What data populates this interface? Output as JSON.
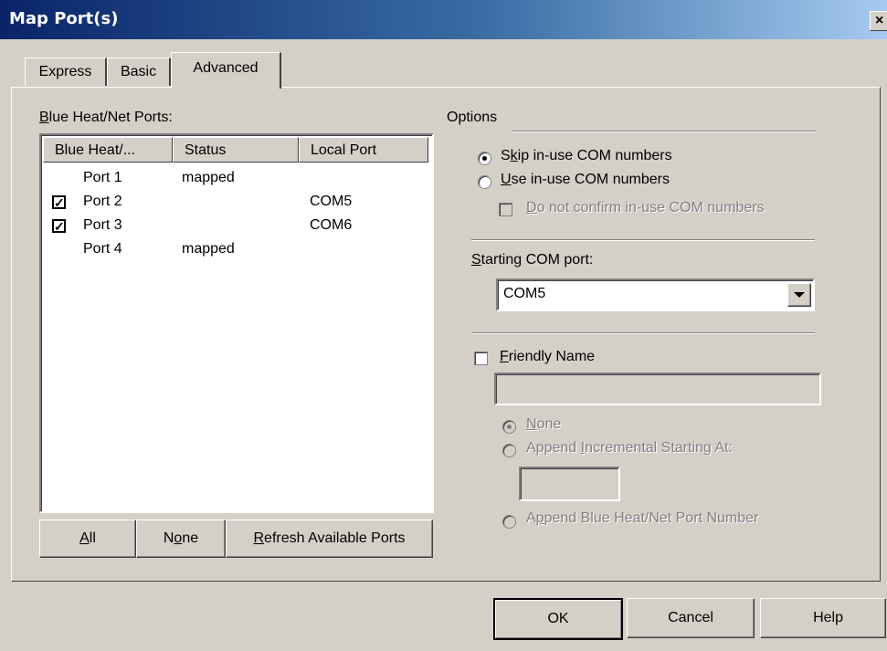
{
  "window": {
    "title": "Map Port(s)",
    "close_glyph": "×"
  },
  "tabs": [
    {
      "label": "Express"
    },
    {
      "label": "Basic"
    },
    {
      "label": "Advanced",
      "selected": true
    }
  ],
  "ports": {
    "label_prefix": "B",
    "label_rest": "lue Heat/Net Ports:",
    "columns": [
      "Blue Heat/...",
      "Status",
      "Local Port"
    ],
    "rows": [
      {
        "name": "Port 1",
        "status": "mapped",
        "local_port": "",
        "checkbox": false
      },
      {
        "name": "Port 2",
        "status": "",
        "local_port": "COM5",
        "checkbox": true
      },
      {
        "name": "Port 3",
        "status": "",
        "local_port": "COM6",
        "checkbox": true
      },
      {
        "name": "Port 4",
        "status": "mapped",
        "local_port": "",
        "checkbox": false
      }
    ],
    "check_glyph": "✓",
    "buttons": {
      "all": {
        "u": "A",
        "rest": "ll"
      },
      "none": {
        "pre": "N",
        "u": "o",
        "rest": "ne"
      },
      "refresh": {
        "u": "R",
        "rest": "efresh Available Ports"
      }
    }
  },
  "options": {
    "heading": "Options",
    "skip_inuse": {
      "pre": "S",
      "u": "k",
      "rest": "ip in-use COM numbers",
      "selected": true
    },
    "use_inuse": {
      "u": "U",
      "rest": "se in-use COM numbers",
      "selected": false
    },
    "no_confirm": {
      "u": "D",
      "rest": "o not confirm in-use COM numbers",
      "checked": false,
      "enabled": false
    },
    "starting_com": {
      "u": "S",
      "rest": "tarting COM port:",
      "value": "COM5"
    },
    "friendly_name": {
      "u": "F",
      "rest": "riendly Name",
      "checked": false,
      "value": ""
    },
    "suffix_none": {
      "u": "N",
      "rest": "one",
      "selected": true
    },
    "append_incremental": {
      "pre": "Append ",
      "u": "I",
      "rest": "ncremental Starting At:",
      "selected": false,
      "value": ""
    },
    "append_port_number": {
      "pre": "A",
      "u": "p",
      "rest": "pend Blue Heat/Net Port Number",
      "selected": false
    }
  },
  "footer": {
    "ok": "OK",
    "cancel": "Cancel",
    "help": "Help"
  },
  "colors": {
    "face": "#d4d0c8",
    "title_start": "#0a246a",
    "title_end": "#a6caf0"
  },
  "icons": {
    "dropdown": "triangle-down-icon",
    "close": "close-icon"
  }
}
